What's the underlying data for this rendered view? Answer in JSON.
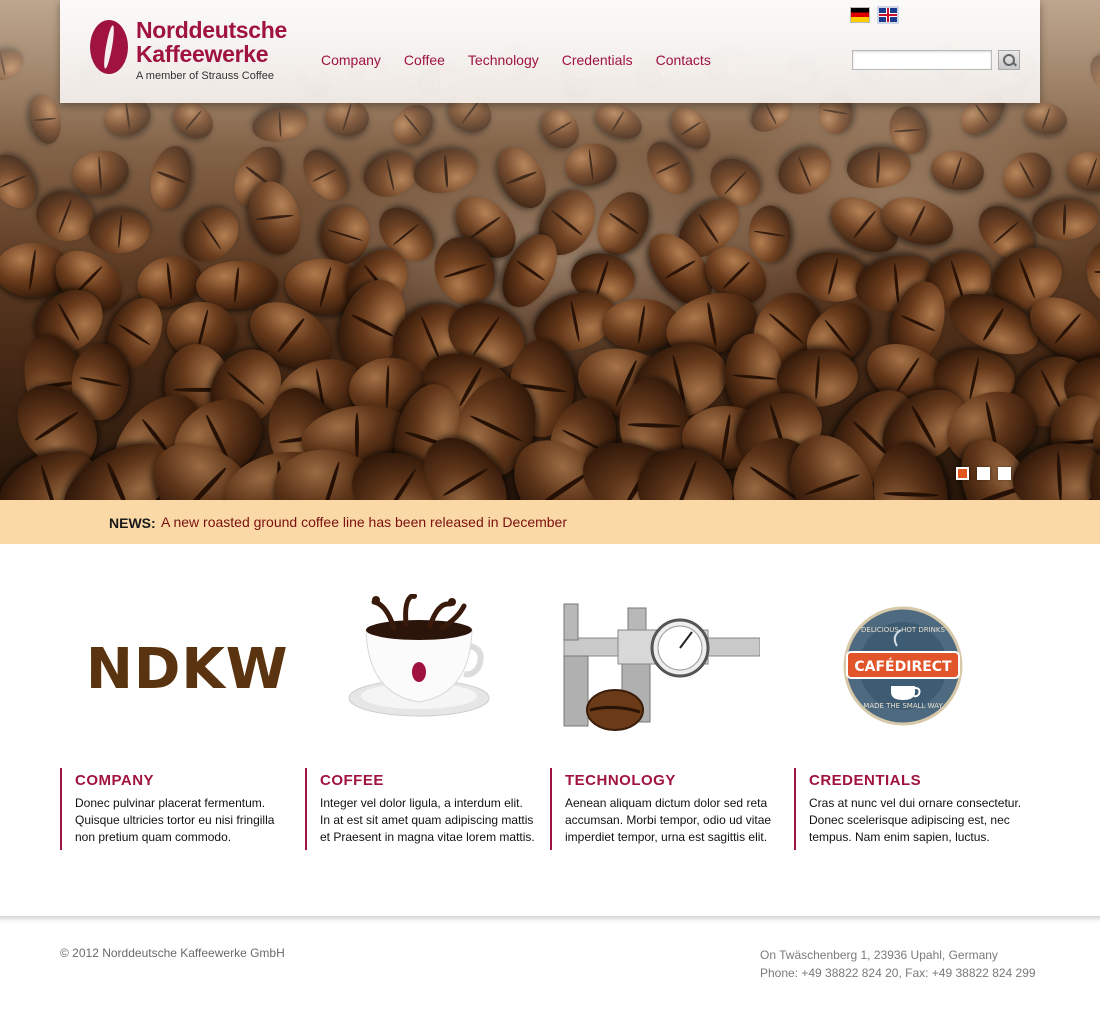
{
  "brand": {
    "name": "Norddeutsche Kaffeewerke",
    "tagline": "A member of Strauss Coffee"
  },
  "nav": [
    {
      "label": "Company"
    },
    {
      "label": "Coffee"
    },
    {
      "label": "Technology"
    },
    {
      "label": "Credentials"
    },
    {
      "label": "Contacts"
    }
  ],
  "languages": [
    "de-flag-icon",
    "uk-flag-icon"
  ],
  "search": {
    "placeholder": ""
  },
  "slider": {
    "slide_count": 3,
    "active_slide": 1
  },
  "news": {
    "label": "NEWS:",
    "text": "A new roasted ground coffee line has been released in December"
  },
  "features": [
    {
      "image_text": "NDKW",
      "title": "COMPANY",
      "text": "Donec pulvinar placerat fermentum. Quisque ultricies tortor eu nisi fringilla non pretium quam commodo."
    },
    {
      "title": "COFFEE",
      "text": "Integer vel dolor ligula, a interdum elit. In at est sit amet quam adipiscing mattis et Praesent in magna vitae lorem mattis."
    },
    {
      "title": "TECHNOLOGY",
      "text": "Aenean aliquam dictum dolor sed reta accumsan. Morbi tempor, odio ud vitae imperdiet tempor, urna est sagittis elit."
    },
    {
      "badge_top": "DELICIOUS HOT DRINKS",
      "badge_main": "CAFÉDIRECT",
      "badge_bottom": "MADE THE SMALL WAY",
      "title": "CREDENTIALS",
      "text": "Cras at nunc vel dui ornare consectetur. Donec scelerisque adipiscing est, nec tempus. Nam enim sapien, luctus."
    }
  ],
  "footer": {
    "copyright": "© 2012 Norddeutsche Kaffeewerke GmbH",
    "address": "On Twäschenberg 1, 23936 Upahl, Germany",
    "phone": "Phone: +49 38822 824 20, Fax: +49 38822 824 299"
  },
  "colors": {
    "brand": "#a0133f",
    "news_bg": "#fad9a6",
    "active_dot": "#e0561d"
  }
}
